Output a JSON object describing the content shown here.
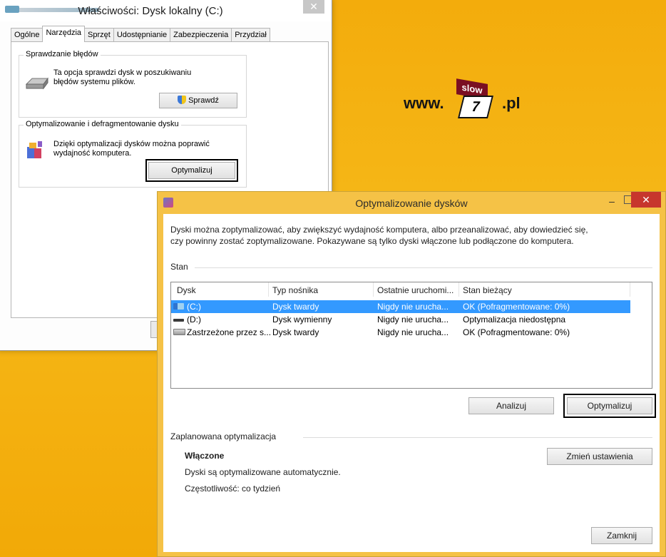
{
  "properties_window": {
    "title": "Właściwości: Dysk lokalny (C:)",
    "close": "✕",
    "tabs": [
      "Ogólne",
      "Narzędzia",
      "Sprzęt",
      "Udostępnianie",
      "Zabezpieczenia",
      "Przydział"
    ],
    "active_tab": "Narzędzia",
    "error_check": {
      "title": "Sprawdzanie błędów",
      "text_line1": "Ta opcja sprawdzi dysk w poszukiwaniu",
      "text_line2": "błędów systemu plików.",
      "button": "Sprawdź"
    },
    "defrag": {
      "title": "Optymalizowanie i defragmentowanie dysku",
      "text_line1": "Dzięki optymalizacji dysków można poprawić",
      "text_line2": "wydajność komputera.",
      "button": "Optymalizuj"
    }
  },
  "watermark": {
    "prefix": "www.",
    "tag": "slow",
    "number": "7",
    "suffix": ".pl"
  },
  "optimize_window": {
    "title": "Optymalizowanie dysków",
    "minimize": "–",
    "close": "✕",
    "description_line1": "Dyski można zoptymalizować, aby zwiększyć wydajność komputera, albo przeanalizować, aby dowiedzieć się,",
    "description_line2": "czy powinny zostać zoptymalizowane. Pokazywane są tylko dyski włączone lub podłączone do komputera.",
    "status_label": "Stan",
    "columns": [
      "Dysk",
      "Typ nośnika",
      "Ostatnie uruchomi...",
      "Stan bieżący"
    ],
    "rows": [
      {
        "disk": "(C:)",
        "media": "Dysk twardy",
        "last_run": "Nigdy nie urucha...",
        "status": "OK (Pofragmentowane: 0%)",
        "icon": "system-drive-icon",
        "selected": true
      },
      {
        "disk": "(D:)",
        "media": "Dysk wymienny",
        "last_run": "Nigdy nie urucha...",
        "status": "Optymalizacja niedostępna",
        "icon": "removable-drive-icon",
        "selected": false
      },
      {
        "disk": "Zastrzeżone przez s...",
        "media": "Dysk twardy",
        "last_run": "Nigdy nie urucha...",
        "status": "OK (Pofragmentowane: 0%)",
        "icon": "hard-drive-icon",
        "selected": false
      }
    ],
    "analyze_button": "Analizuj",
    "optimize_button": "Optymalizuj",
    "scheduled_label": "Zaplanowana optymalizacja",
    "scheduled_state": "Włączone",
    "scheduled_desc": "Dyski są optymalizowane automatycznie.",
    "frequency": "Częstotliwość: co tydzień",
    "change_settings_button": "Zmień ustawienia",
    "close_button": "Zamknij"
  }
}
